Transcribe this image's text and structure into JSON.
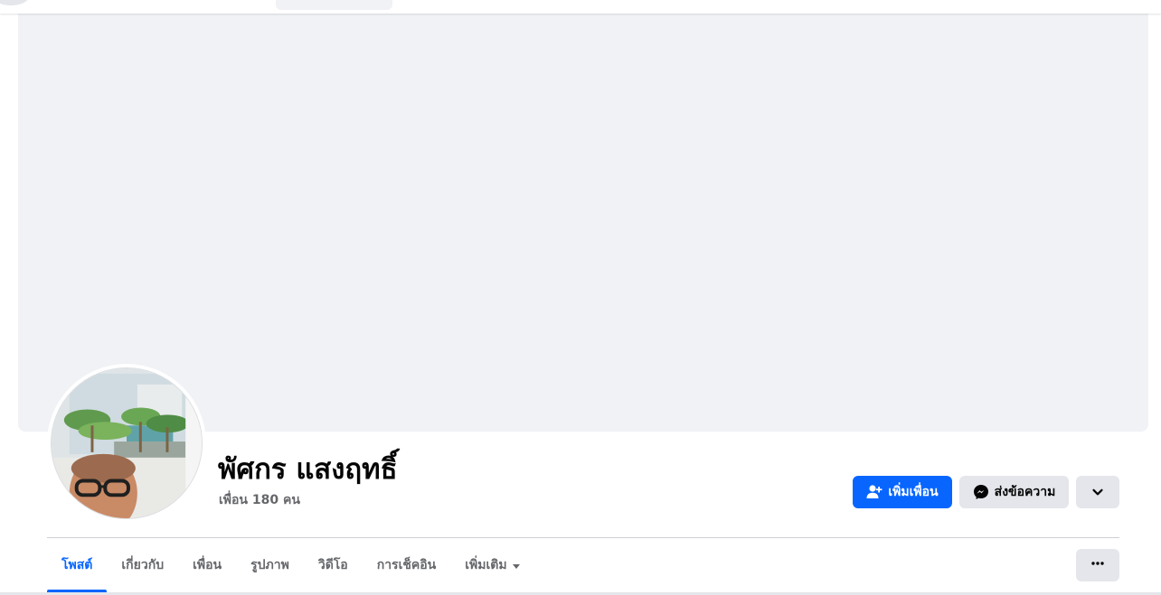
{
  "profile": {
    "name": "พัศกร แสงฤทธิ์",
    "friends_count": "เพื่อน 180 คน"
  },
  "actions": {
    "add_friend_label": "เพิ่มเพื่อน",
    "message_label": "ส่งข้อความ"
  },
  "tabs": [
    {
      "label": "โพสต์",
      "active": true
    },
    {
      "label": "เกี่ยวกับ",
      "active": false
    },
    {
      "label": "เพื่อน",
      "active": false
    },
    {
      "label": "รูปภาพ",
      "active": false
    },
    {
      "label": "วิดีโอ",
      "active": false
    },
    {
      "label": "การเช็คอิน",
      "active": false
    },
    {
      "label": "เพิ่มเติม",
      "active": false
    }
  ],
  "colors": {
    "accent": "#0866ff",
    "cover_bg": "#f0f2f5",
    "secondary_button": "#e4e6eb",
    "muted_text": "#65676b"
  },
  "icons": {
    "add_friend": "person-plus-icon",
    "message": "messenger-icon",
    "dropdown": "chevron-down-icon",
    "more_tabs": "more-dots-icon",
    "more_caret": "caret-down-icon"
  }
}
